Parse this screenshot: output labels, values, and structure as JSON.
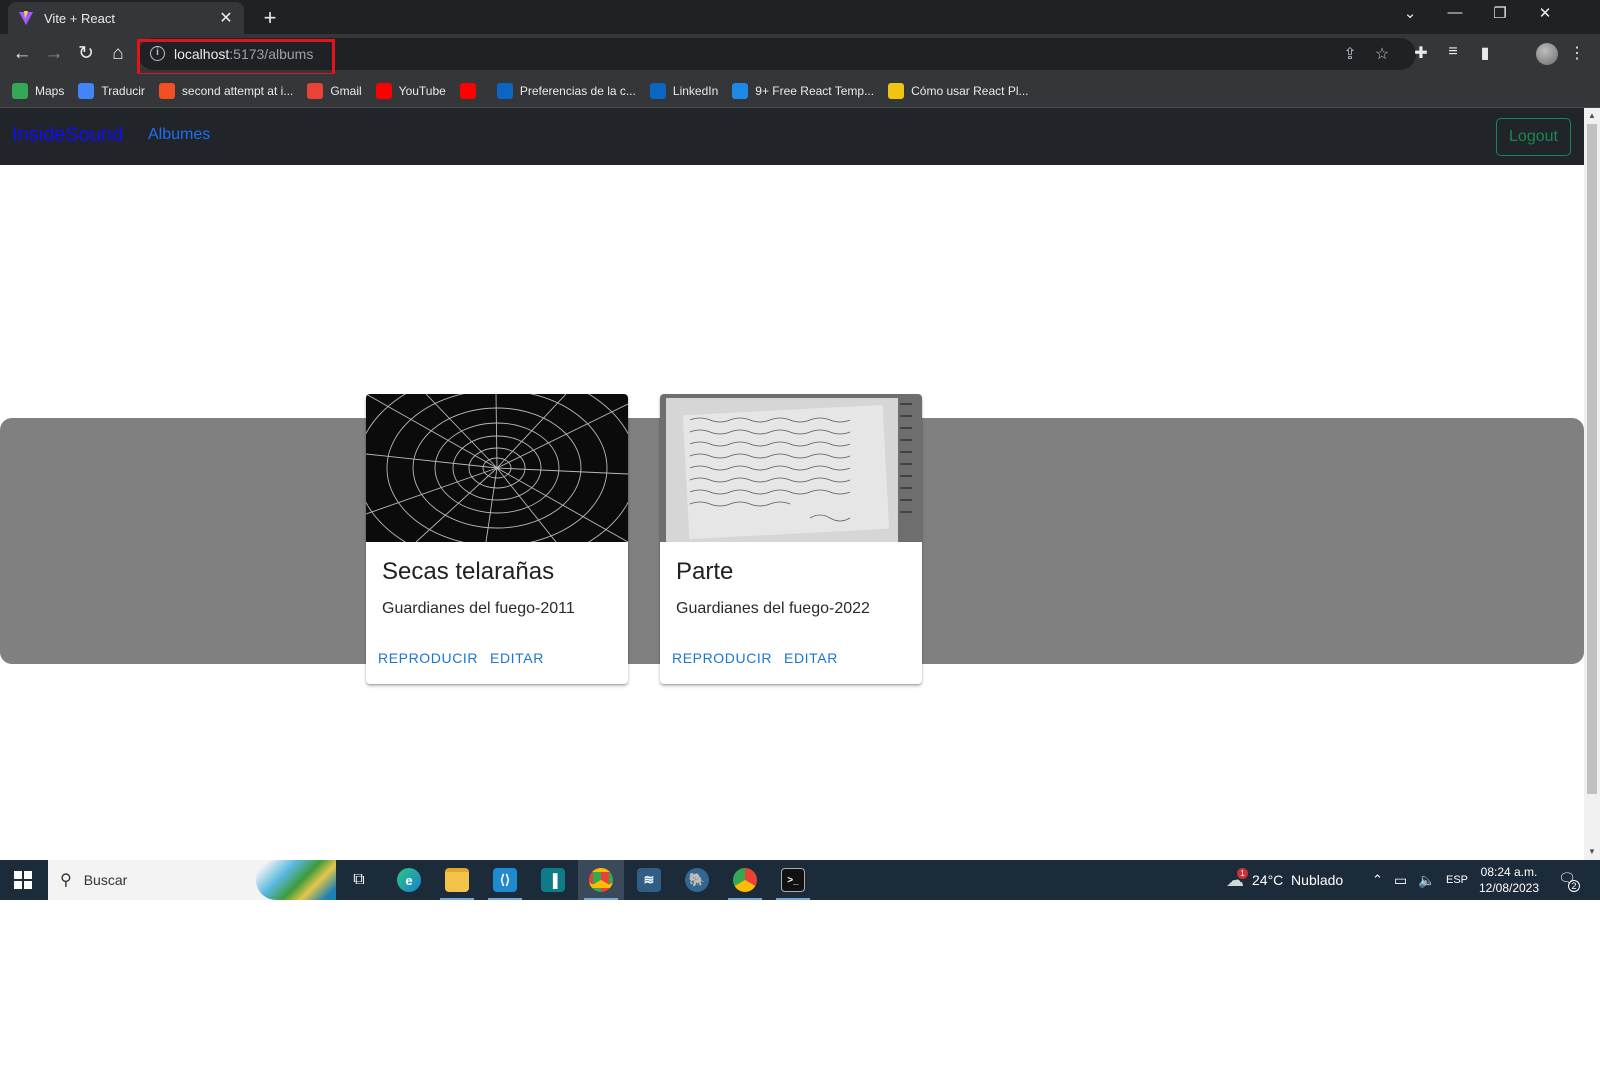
{
  "browser": {
    "tab_title": "Vite + React",
    "url_host": "localhost",
    "url_path": ":5173/albums",
    "bookmarks": [
      {
        "label": "Maps",
        "icon": "maps-icon",
        "color": "#34a853"
      },
      {
        "label": "Traducir",
        "icon": "translate-icon",
        "color": "#4285f4"
      },
      {
        "label": "second attempt at i...",
        "icon": "microsoft-icon",
        "color": "#f25022"
      },
      {
        "label": "Gmail",
        "icon": "gmail-icon",
        "color": "#ea4335"
      },
      {
        "label": "YouTube",
        "icon": "youtube-icon",
        "color": "#ff0000"
      },
      {
        "label": "",
        "icon": "youtube-music-icon",
        "color": "#ff0000"
      },
      {
        "label": "Preferencias de la c...",
        "icon": "linkedin-icon",
        "color": "#0a66c2"
      },
      {
        "label": "LinkedIn",
        "icon": "linkedin-icon",
        "color": "#0a66c2"
      },
      {
        "label": "9+ Free React Temp...",
        "icon": "mui-icon",
        "color": "#1e88e5"
      },
      {
        "label": "Cómo usar React Pl...",
        "icon": "ninja-icon",
        "color": "#f1c40f"
      }
    ]
  },
  "app": {
    "brand": "InsideSound",
    "nav_link": "Albumes",
    "logout_label": "Logout",
    "albums": [
      {
        "title": "Secas telarañas",
        "subtitle": "Guardianes del fuego-2011",
        "play_label": "REPRODUCIR",
        "edit_label": "EDITAR",
        "image": "spiderweb-photo"
      },
      {
        "title": "Parte",
        "subtitle": "Guardianes del fuego-2022",
        "play_label": "REPRODUCIR",
        "edit_label": "EDITAR",
        "image": "handwritten-notebook-photo"
      }
    ]
  },
  "taskbar": {
    "search_placeholder": "Buscar",
    "weather": "24°C  Nublado",
    "weather_badge": "1",
    "language": "ESP",
    "time": "08:24 a.m.",
    "date": "12/08/2023",
    "notifications": "2"
  }
}
